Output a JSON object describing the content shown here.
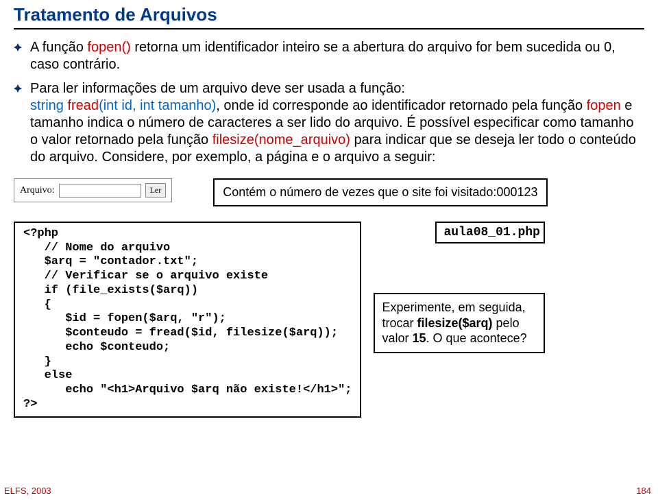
{
  "title": "Tratamento de Arquivos",
  "bullets": {
    "b1": {
      "pre1": "A função ",
      "fn1": "fopen()",
      "post1": " retorna um identificador inteiro se a abertura do arquivo for bem sucedida ou 0, caso contrário."
    },
    "b2": {
      "pre1": "Para ler informações de um arquivo deve ser usada a função:",
      "sig_a": "string ",
      "sig_b": "fread",
      "sig_c": "(int id, int tamanho)",
      "mid1": ", onde id corresponde ao identificador retornado pela função ",
      "fn_fop": "fopen",
      "mid2": " e tamanho indica o número de caracteres a ser lido do arquivo. É possível especificar como tamanho o valor retornado pela função ",
      "fn_fs": "filesize(nome_arquivo)",
      "mid3": " para indicar que se deseja ler todo o conteúdo do arquivo. Considere, por exemplo, a página e o arquivo a seguir:"
    }
  },
  "form": {
    "label": "Arquivo:",
    "value": "",
    "button": "Ler"
  },
  "countbox": "Contém o número de vezes que o site foi visitado:000123",
  "code": "<?php\n   // Nome do arquivo\n   $arq = \"contador.txt\";\n   // Verificar se o arquivo existe\n   if (file_exists($arq))\n   {\n      $id = fopen($arq, \"r\");\n      $conteudo = fread($id, filesize($arq));\n      echo $conteudo;\n   }\n   else\n      echo \"<h1>Arquivo $arq não existe!</h1>\";\n?>",
  "filename": "aula08_01.php",
  "tip": {
    "t1": "Experimente, em seguida, trocar ",
    "b1": "filesize($arq)",
    "t2": " pelo valor ",
    "b2": "15",
    "t3": ". O que acontece?"
  },
  "footer": {
    "left": "ELFS, 2003",
    "right": "184"
  }
}
